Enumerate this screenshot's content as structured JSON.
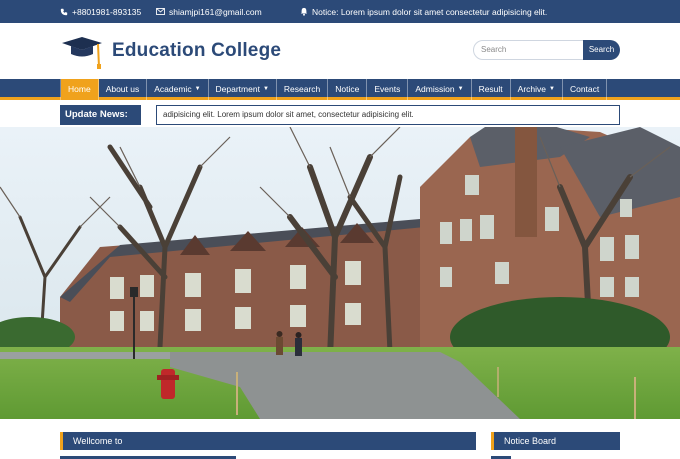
{
  "topbar": {
    "phone": "+8801981-893135",
    "email": "shiamjpi161@gmail.com",
    "notice": "Notice: Lorem ipsum dolor sit amet consectetur adipisicing elit."
  },
  "header": {
    "title": "Education College",
    "search_placeholder": "Search",
    "search_button": "Search"
  },
  "nav": {
    "items": [
      {
        "label": "Home"
      },
      {
        "label": "About us"
      },
      {
        "label": "Academic"
      },
      {
        "label": "Department"
      },
      {
        "label": "Research"
      },
      {
        "label": "Notice"
      },
      {
        "label": "Events"
      },
      {
        "label": "Admission"
      },
      {
        "label": "Result"
      },
      {
        "label": "Archive"
      },
      {
        "label": "Contact"
      }
    ]
  },
  "news": {
    "label": "Update News:",
    "text": "adipisicing elit.    Lorem ipsum dolor sit amet, consectetur adipisicing elit."
  },
  "panels": {
    "welcome": "Wellcome to",
    "notice_board": "Notice Board"
  },
  "colors": {
    "primary": "#2c4a78",
    "accent": "#f0a21c"
  }
}
